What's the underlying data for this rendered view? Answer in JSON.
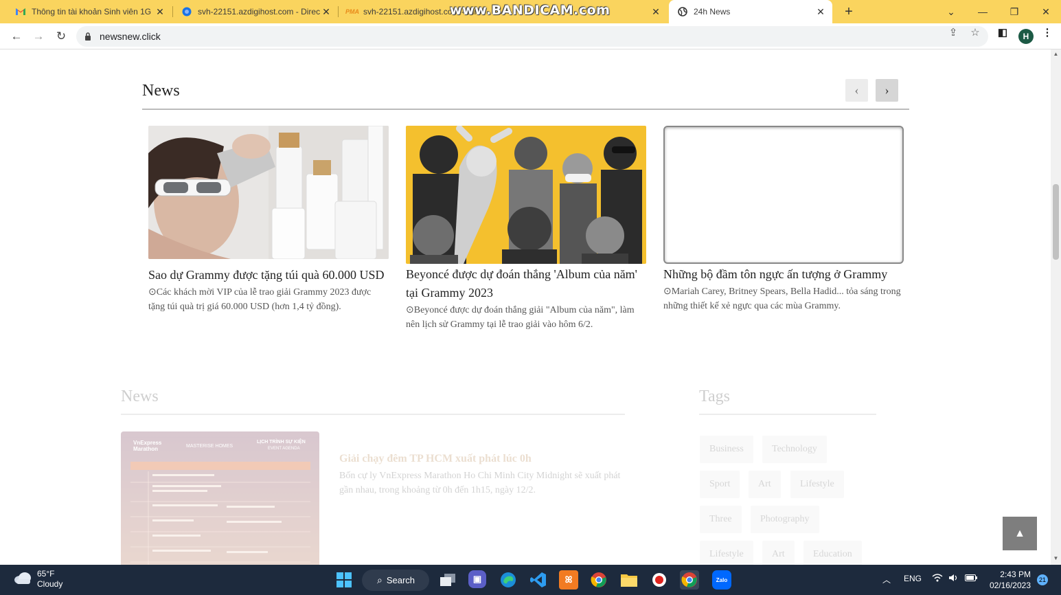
{
  "browser": {
    "tabs": [
      {
        "title": "Thông tin tài khoản Sinh viên 1G",
        "icon": "gmail-icon"
      },
      {
        "title": "svh-22151.azdigihost.com - Direc",
        "icon": "globe-blue-icon"
      },
      {
        "title": "svh-22151.azdigihost.com - Direc",
        "icon": "phpmyadmin-icon"
      },
      {
        "title": "24h News",
        "icon": "globe-icon",
        "active": true
      }
    ],
    "watermark": "www.BANDICAM.com",
    "url": "newsnew.click",
    "profile_initial": "H"
  },
  "page": {
    "slider_section_title": "News",
    "cards": [
      {
        "headline": "Sao dự Grammy được tặng túi quà 60.000 USD",
        "summary": "Các khách mời VIP của lễ trao giải Grammy 2023 được tặng túi quà trị giá 60.000 USD (hơn 1,4 tỷ đồng)."
      },
      {
        "headline": "Beyoncé được dự đoán thắng 'Album của năm' tại Grammy 2023",
        "summary": "Beyoncé được dự đoán thắng giải \"Album của năm\", làm nên lịch sử Grammy tại lễ trao giải vào hôm 6/2."
      },
      {
        "headline": "Những bộ đầm tôn ngực ấn tượng ở Grammy",
        "summary": "Mariah Carey, Britney Spears, Bella Hadid... tỏa sáng trong những thiết kế xẻ ngực qua các mùa Grammy."
      }
    ],
    "news_section_title": "News",
    "tags_section_title": "Tags",
    "tags": [
      "Business",
      "Technology",
      "Sport",
      "Art",
      "Lifestyle",
      "Three",
      "Photography",
      "Lifestyle",
      "Art",
      "Education"
    ],
    "post": {
      "title": "Giải chạy đêm TP HCM xuất phát lúc 0h",
      "summary": "Bốn cự ly VnExpress Marathon Ho Chi Minh City Midnight sẽ xuất phát gần nhau, trong khoảng từ 0h đến 1h15, ngày 12/2."
    },
    "agenda_image": {
      "brand_left": "VnExpress Marathon",
      "brand_mid": "MASTERISE HOMES",
      "brand_right": "LỊCH TRÌNH SỰ KIỆN",
      "brand_right_sub": "EVENT AGENDA"
    }
  },
  "taskbar": {
    "weather_temp": "65°F",
    "weather_desc": "Cloudy",
    "search_label": "Search",
    "language": "ENG",
    "time": "2:43 PM",
    "date": "02/16/2023",
    "notifications": "21"
  }
}
